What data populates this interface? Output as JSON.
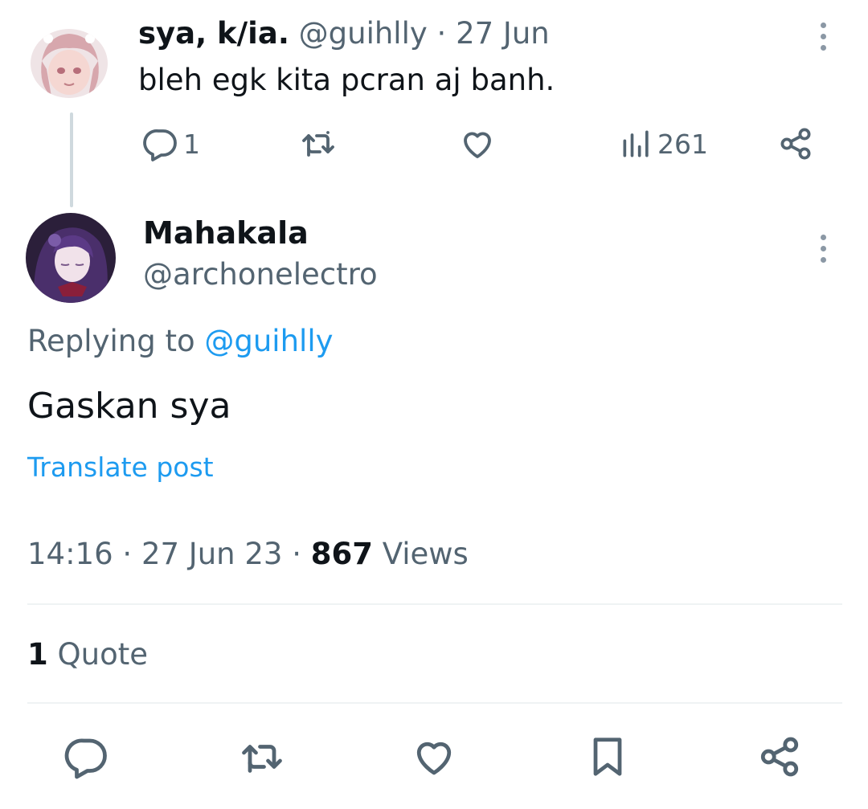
{
  "parent": {
    "name": "sya, k/ia.",
    "handle": "@guihlly",
    "separator": "·",
    "date": "27 Jun",
    "text": "bleh egk kita pcran aj banh.",
    "replies": "1",
    "views": "261"
  },
  "main": {
    "name": "Mahakala",
    "handle": "@archonelectro",
    "replying_prefix": "Replying to",
    "replying_handle": "@guihlly",
    "text": "Gaskan sya",
    "translate": "Translate post",
    "time": "14:16",
    "sep1": "·",
    "date": "27 Jun 23",
    "sep2": "·",
    "views_count": "867",
    "views_label": "Views",
    "quote_count": "1",
    "quote_label": "Quote"
  },
  "icons": {
    "reply": "reply-icon",
    "retweet": "retweet-icon",
    "like": "heart-icon",
    "views": "views-icon",
    "share": "share-icon",
    "bookmark": "bookmark-icon",
    "more": "more-icon"
  },
  "colors": {
    "text": "#0f1419",
    "muted": "#536471",
    "link": "#1d9bf0",
    "divider": "#eff3f4"
  }
}
